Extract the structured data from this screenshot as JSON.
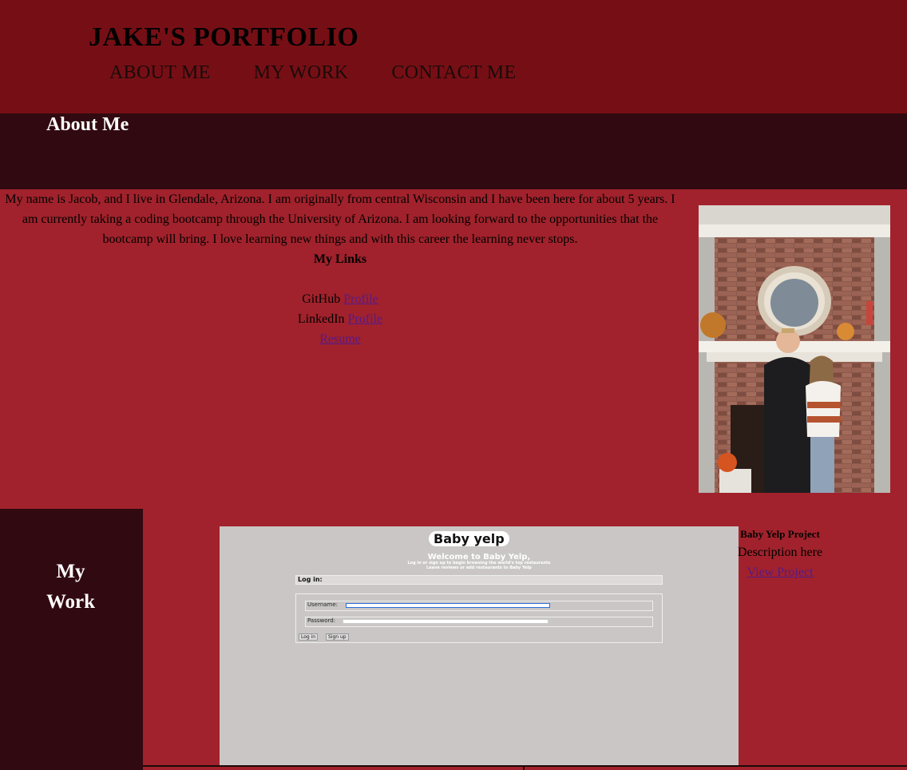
{
  "header": {
    "title": "JAKE'S PORTFOLIO",
    "nav": [
      "ABOUT ME",
      "MY WORK",
      "CONTACT ME"
    ]
  },
  "about": {
    "heading": "About Me",
    "bio": "My name is Jacob, and I live in Glendale, Arizona. I am originally from central Wisconsin and I have been here for about 5 years. I am currently taking a coding bootcamp through the University of Arizona. I am looking forward to the opportunities that the bootcamp will bring. I love learning new things and with this career the learning never stops.",
    "links_heading": "My Links",
    "github_label": "GitHub",
    "github_link": "Profile",
    "linkedin_label": "LinkedIn",
    "linkedin_link": "Profile",
    "resume_link": "Resume"
  },
  "work": {
    "heading_line1": "My",
    "heading_line2": "Work",
    "project_title": "Baby Yelp Project",
    "project_desc": "Description here",
    "project_link": "View Project",
    "screenshot": {
      "logo": "Baby yelp",
      "welcome": "Welcome to Baby Yelp,",
      "sub1": "Log in or sign up to begin browsing the world's top restaurants",
      "sub2": "Leave reviews or add restaurants to Baby Yelp",
      "login_heading": "Log in:",
      "username_label": "Username:",
      "password_label": "Password:",
      "login_button": "Log in",
      "signup_button": "Sign up"
    }
  },
  "colors": {
    "header_bg": "#760f15",
    "page_bg": "#a1222c",
    "dark_bar": "#310910"
  }
}
